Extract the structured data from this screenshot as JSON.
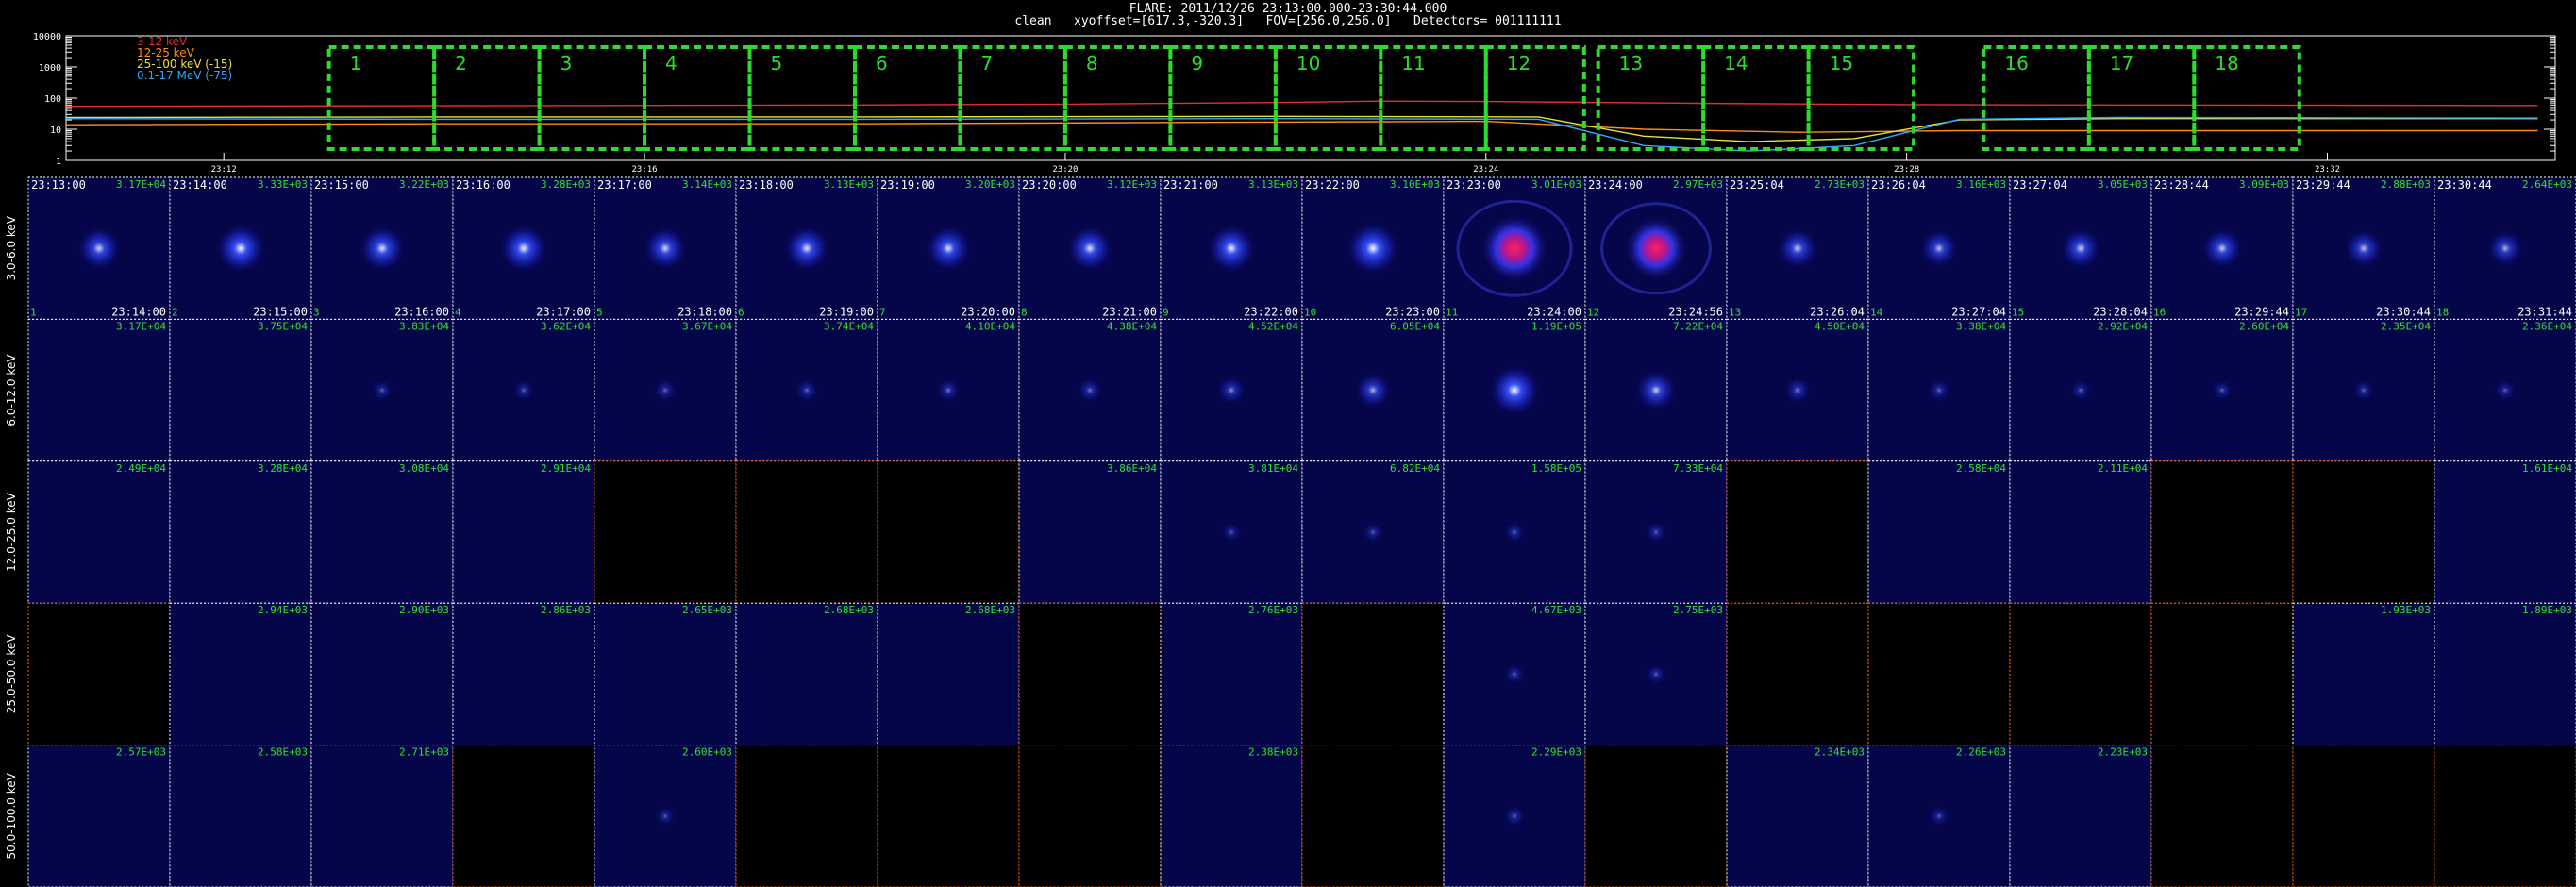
{
  "header": {
    "line1": "FLARE: 2011/12/26 23:13:00.000-23:30:44.000",
    "line2": "clean   xyoffset=[617.3,-320.3]   FOV=[256.0,256.0]   Detectors= 001111111"
  },
  "chart_data": [
    {
      "type": "line",
      "name": "lightcurve",
      "ytick_labels": [
        "10000",
        "1000",
        "100",
        "10",
        "1"
      ],
      "ylog": true,
      "ylim": [
        1,
        10000
      ],
      "xlim": [
        "23:10:30",
        "23:34:10"
      ],
      "xtick_labels": [
        "23:12",
        "23:16",
        "23:20",
        "23:24",
        "23:28",
        "23:32"
      ],
      "legend": [
        {
          "label": "3-12 keV",
          "color": "#e03030"
        },
        {
          "label": "12-25 keV",
          "color": "#ff8c1a"
        },
        {
          "label": "25-100 keV (-15)",
          "color": "#e8e23a"
        },
        {
          "label": "0.1-17 MeV (-75)",
          "color": "#2aa8ff"
        }
      ],
      "series": [
        {
          "name": "3-12 keV",
          "color": "#e03030",
          "x": [
            "23:10:30",
            "23:14:00",
            "23:18:00",
            "23:20:00",
            "23:22:00",
            "23:23:00",
            "23:24:00",
            "23:26:00",
            "23:28:00",
            "23:30:00",
            "23:34:00"
          ],
          "y": [
            55,
            57,
            60,
            64,
            72,
            80,
            78,
            68,
            62,
            60,
            58
          ]
        },
        {
          "name": "12-25 keV",
          "color": "#ff8c1a",
          "x": [
            "23:10:30",
            "23:14:00",
            "23:18:00",
            "23:22:00",
            "23:24:00",
            "23:25:30",
            "23:27:00",
            "23:28:30",
            "23:30:00",
            "23:34:00"
          ],
          "y": [
            14,
            15,
            15,
            17,
            18,
            10,
            8,
            9,
            9,
            9
          ]
        },
        {
          "name": "25-100 keV (-15)",
          "color": "#e8e23a",
          "x": [
            "23:10:30",
            "23:14:00",
            "23:18:00",
            "23:22:00",
            "23:24:30",
            "23:25:30",
            "23:26:30",
            "23:27:30",
            "23:28:30",
            "23:30:00",
            "23:34:00"
          ],
          "y": [
            24,
            25,
            25,
            26,
            25,
            6,
            4,
            5,
            20,
            22,
            22
          ]
        },
        {
          "name": "0.1-17 MeV (-75)",
          "color": "#2aa8ff",
          "x": [
            "23:10:30",
            "23:14:00",
            "23:18:00",
            "23:22:00",
            "23:24:30",
            "23:25:30",
            "23:26:30",
            "23:27:30",
            "23:28:30",
            "23:30:00",
            "23:34:00"
          ],
          "y": [
            22,
            21,
            21,
            22,
            21,
            3,
            2,
            3,
            21,
            24,
            23
          ]
        }
      ],
      "interval_boxes": [
        {
          "label": "1",
          "start": "23:13:00",
          "end": "23:14:00"
        },
        {
          "label": "2",
          "start": "23:14:00",
          "end": "23:15:00"
        },
        {
          "label": "3",
          "start": "23:15:00",
          "end": "23:16:00"
        },
        {
          "label": "4",
          "start": "23:16:00",
          "end": "23:17:00"
        },
        {
          "label": "5",
          "start": "23:17:00",
          "end": "23:18:00"
        },
        {
          "label": "6",
          "start": "23:18:00",
          "end": "23:19:00"
        },
        {
          "label": "7",
          "start": "23:19:00",
          "end": "23:20:00"
        },
        {
          "label": "8",
          "start": "23:20:00",
          "end": "23:21:00"
        },
        {
          "label": "9",
          "start": "23:21:00",
          "end": "23:22:00"
        },
        {
          "label": "10",
          "start": "23:22:00",
          "end": "23:23:00"
        },
        {
          "label": "11",
          "start": "23:23:00",
          "end": "23:24:00"
        },
        {
          "label": "12",
          "start": "23:24:00",
          "end": "23:24:56"
        },
        {
          "label": "13",
          "start": "23:25:04",
          "end": "23:26:04"
        },
        {
          "label": "14",
          "start": "23:26:04",
          "end": "23:27:04"
        },
        {
          "label": "15",
          "start": "23:27:04",
          "end": "23:28:04"
        },
        {
          "label": "16",
          "start": "23:28:44",
          "end": "23:29:44"
        },
        {
          "label": "17",
          "start": "23:29:44",
          "end": "23:30:44"
        },
        {
          "label": "18",
          "start": "23:30:44",
          "end": "23:31:44"
        }
      ]
    },
    {
      "type": "heatmap",
      "name": "image-grid",
      "row_labels": [
        "3.0-6.0 keV",
        "6.0-12.0 keV",
        "12.0-25.0 keV",
        "25.0-50.0 keV",
        "50.0-100.0 keV"
      ],
      "columns": [
        {
          "index": "1",
          "start": "23:13:00",
          "end": "23:14:00"
        },
        {
          "index": "2",
          "start": "23:14:00",
          "end": "23:15:00"
        },
        {
          "index": "3",
          "start": "23:15:00",
          "end": "23:16:00"
        },
        {
          "index": "4",
          "start": "23:16:00",
          "end": "23:17:00"
        },
        {
          "index": "5",
          "start": "23:17:00",
          "end": "23:18:00"
        },
        {
          "index": "6",
          "start": "23:18:00",
          "end": "23:19:00"
        },
        {
          "index": "7",
          "start": "23:19:00",
          "end": "23:20:00"
        },
        {
          "index": "8",
          "start": "23:20:00",
          "end": "23:21:00"
        },
        {
          "index": "9",
          "start": "23:21:00",
          "end": "23:22:00"
        },
        {
          "index": "10",
          "start": "23:22:00",
          "end": "23:23:00"
        },
        {
          "index": "11",
          "start": "23:23:00",
          "end": "23:24:00"
        },
        {
          "index": "12",
          "start": "23:24:00",
          "end": "23:24:56"
        },
        {
          "index": "13",
          "start": "23:25:04",
          "end": "23:26:04"
        },
        {
          "index": "14",
          "start": "23:26:04",
          "end": "23:27:04"
        },
        {
          "index": "15",
          "start": "23:27:04",
          "end": "23:28:04"
        },
        {
          "index": "16",
          "start": "23:28:44",
          "end": "23:29:44"
        },
        {
          "index": "17",
          "start": "23:29:44",
          "end": "23:30:44"
        },
        {
          "index": "18",
          "start": "23:30:44",
          "end": "23:31:44"
        }
      ],
      "cells": [
        [
          "3.17E+04",
          "3.33E+03",
          "3.22E+03",
          "3.28E+03",
          "3.14E+03",
          "3.13E+03",
          "3.20E+03",
          "3.12E+03",
          "3.13E+03",
          "3.10E+03",
          "3.01E+03",
          "2.97E+03",
          "2.73E+03",
          "3.16E+03",
          "3.05E+03",
          "3.09E+03",
          "2.88E+03",
          "2.64E+03"
        ],
        [
          "3.17E+04",
          "3.75E+04",
          "3.83E+04",
          "3.62E+04",
          "3.67E+04",
          "3.74E+04",
          "4.10E+04",
          "4.38E+04",
          "4.52E+04",
          "6.05E+04",
          "1.19E+05",
          "7.22E+04",
          "4.50E+04",
          "3.38E+04",
          "2.92E+04",
          "2.60E+04",
          "2.35E+04",
          "2.36E+04"
        ],
        [
          "2.49E+04",
          "3.28E+04",
          "3.08E+04",
          "2.91E+04",
          "",
          "",
          "",
          "3.86E+04",
          "3.81E+04",
          "6.82E+04",
          "1.58E+05",
          "7.33E+04",
          "",
          "2.58E+04",
          "2.11E+04",
          "",
          "",
          "1.61E+04"
        ],
        [
          "",
          "2.94E+03",
          "2.90E+03",
          "2.86E+03",
          "2.65E+03",
          "2.68E+03",
          "2.68E+03",
          "",
          "2.76E+03",
          "",
          "4.67E+03",
          "2.75E+03",
          "",
          "",
          "",
          "",
          "1.93E+03",
          "1.89E+03"
        ],
        [
          "2.57E+03",
          "2.58E+03",
          "2.71E+03",
          "",
          "2.60E+03",
          "",
          "",
          "",
          "2.38E+03",
          "",
          "2.29E+03",
          "",
          "2.34E+03",
          "2.26E+03",
          "2.23E+03",
          "",
          "",
          ""
        ]
      ],
      "source_intensity": [
        [
          0.5,
          0.62,
          0.55,
          0.6,
          0.5,
          0.55,
          0.55,
          0.55,
          0.6,
          0.7,
          1.0,
          0.9,
          0.45,
          0.4,
          0.45,
          0.45,
          0.4,
          0.35
        ],
        [
          0,
          0,
          0.05,
          0.05,
          0.08,
          0.08,
          0.1,
          0.12,
          0.2,
          0.35,
          0.65,
          0.45,
          0.15,
          0.08,
          0.05,
          0.05,
          0.05,
          0.05
        ],
        [
          0,
          0,
          0,
          0,
          0,
          0,
          0,
          0,
          0.02,
          0.04,
          0.05,
          0.05,
          0,
          0,
          0,
          0,
          0,
          0
        ],
        [
          0,
          0,
          0,
          0,
          0,
          0,
          0,
          0,
          0,
          0,
          0.04,
          0.04,
          0,
          0,
          0,
          0,
          0,
          0
        ],
        [
          0,
          0,
          0,
          0,
          0.03,
          0,
          0,
          0,
          0,
          0,
          0.05,
          0,
          0,
          0.03,
          0,
          0,
          0,
          0
        ]
      ],
      "colors": {
        "grid_border": "#ffffff",
        "empty_border": "#ff6a1a",
        "interval_box": "#2bdc2b",
        "value_label": "#33e033"
      }
    }
  ]
}
